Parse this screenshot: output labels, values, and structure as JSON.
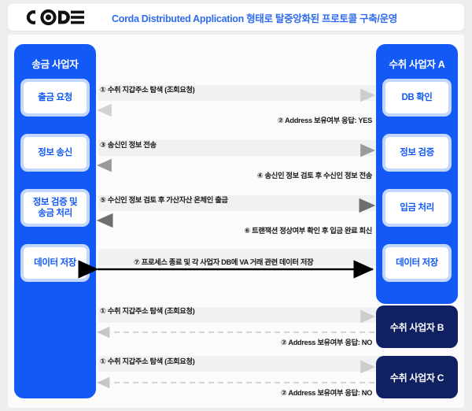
{
  "header": {
    "logo_name": "CODE",
    "title": "Corda Distributed Application 형태로 탈중앙화된 프로토콜 구축/운영",
    "title_color": "#2f6bed"
  },
  "colors": {
    "primary_blue": "#1259f5",
    "node_border": "#c3d6fd",
    "navy": "#0f2063",
    "canvas_bg": "#fbfbfc",
    "band": "#f0f1f3"
  },
  "diagram": {
    "type": "sequence-diagram",
    "left_actor": {
      "title": "송금 사업자",
      "nodes": [
        {
          "label": "출금 요청"
        },
        {
          "label": "정보 송신"
        },
        {
          "label": "정보 검증 및\n송금 처리"
        },
        {
          "label": "데이터 저장"
        }
      ]
    },
    "right_actor_a": {
      "title": "수취 사업자 A",
      "nodes": [
        {
          "label": "DB 확인"
        },
        {
          "label": "정보 검증"
        },
        {
          "label": "입금 처리"
        },
        {
          "label": "데이터 저장"
        }
      ]
    },
    "other_actors": [
      {
        "label": "수취 사업자 B"
      },
      {
        "label": "수취 사업자 C"
      }
    ],
    "messages": [
      {
        "id": "m1",
        "number": "①",
        "text": "① 수취 지갑주소 탐색 (조회요청)",
        "direction": "right",
        "style": "solid-light"
      },
      {
        "id": "m2",
        "number": "②",
        "text": "② Address 보유여부 응답: YES",
        "direction": "left",
        "style": "solid-light"
      },
      {
        "id": "m3",
        "number": "③",
        "text": "③ 송신인 정보 전송",
        "direction": "right",
        "style": "solid"
      },
      {
        "id": "m4",
        "number": "④",
        "text": "④ 송신인 정보 검토 후 수신인 정보 전송",
        "direction": "left",
        "style": "solid"
      },
      {
        "id": "m5",
        "number": "⑤",
        "text": "⑤ 수신인 정보 검토 후 가산자산 온체인 출금",
        "direction": "right",
        "style": "solid-dark"
      },
      {
        "id": "m6",
        "number": "⑥",
        "text": "⑥ 트랜잭션 정상여부 확인 후 입금 완료 회신",
        "direction": "left",
        "style": "solid-dark"
      },
      {
        "id": "m7",
        "number": "⑦",
        "text": "⑦  프로세스 종료 및 각 사업자 DB에 VA 거래 관련 데이터 저장",
        "direction": "both",
        "style": "solid-black"
      },
      {
        "id": "m8",
        "number": "①",
        "text": "① 수취 지갑주소 탐색 (조회요청)",
        "direction": "right",
        "style": "solid-light"
      },
      {
        "id": "m9",
        "number": "②",
        "text": "② Address 보유여부 응답: NO",
        "direction": "left",
        "style": "dashed"
      },
      {
        "id": "m10",
        "number": "①",
        "text": "① 수취 지갑주소 탐색 (조회요청)",
        "direction": "right",
        "style": "solid-light"
      },
      {
        "id": "m11",
        "number": "②",
        "text": "② Address 보유여부 응답: NO",
        "direction": "left",
        "style": "dashed"
      }
    ]
  }
}
